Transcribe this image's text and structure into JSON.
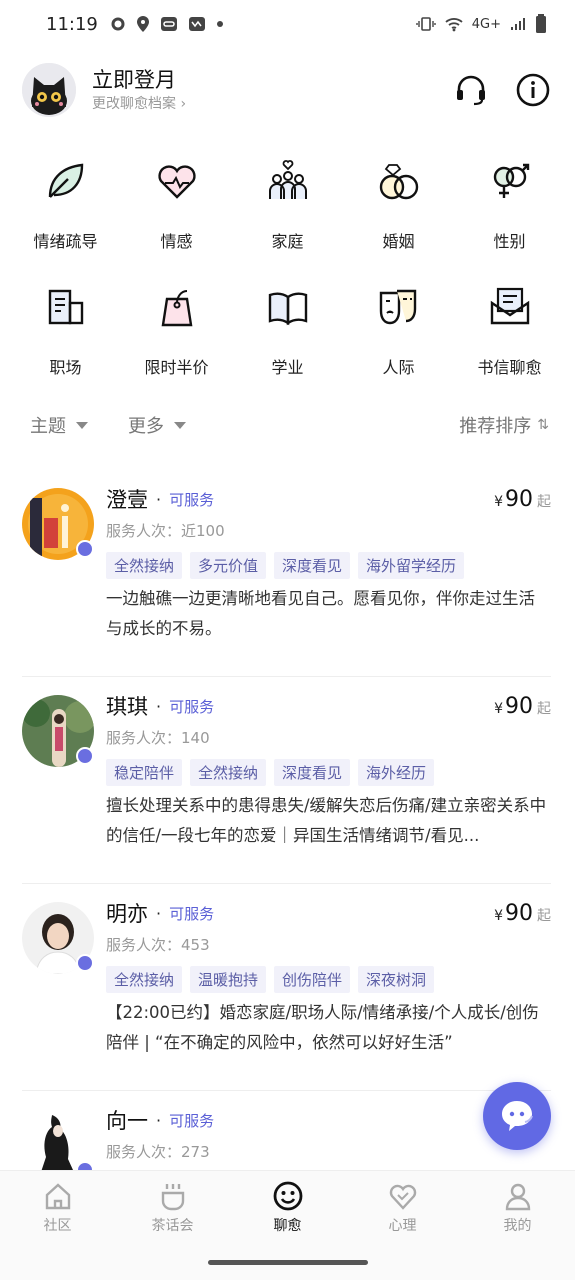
{
  "status_bar": {
    "time": "11:19",
    "network": "4G+"
  },
  "header": {
    "title": "立即登月",
    "subtitle": "更改聊愈档案 ›"
  },
  "categories": [
    {
      "label": "情绪疏导",
      "icon": "leaf-icon"
    },
    {
      "label": "情感",
      "icon": "heart-icon"
    },
    {
      "label": "家庭",
      "icon": "family-icon"
    },
    {
      "label": "婚姻",
      "icon": "rings-icon"
    },
    {
      "label": "性别",
      "icon": "gender-icon"
    },
    {
      "label": "职场",
      "icon": "office-icon"
    },
    {
      "label": "限时半价",
      "icon": "price-tag-icon"
    },
    {
      "label": "学业",
      "icon": "book-icon"
    },
    {
      "label": "人际",
      "icon": "masks-icon"
    },
    {
      "label": "书信聊愈",
      "icon": "letter-icon"
    }
  ],
  "filters": {
    "topic": "主题",
    "more": "更多",
    "sort": "推荐排序",
    "sort_icon": "⇅"
  },
  "counselors": [
    {
      "name": "澄壹",
      "status": "可服务",
      "served": "服务人次：近100",
      "currency": "¥",
      "price": "90",
      "price_suffix": "起",
      "tags": [
        "全然接纳",
        "多元价值",
        "深度看见",
        "海外留学经历"
      ],
      "desc": "一边触礁一边更清晰地看见自己。愿看见你，伴你走过生活与成长的不易。"
    },
    {
      "name": "琪琪",
      "status": "可服务",
      "served": "服务人次：140",
      "currency": "¥",
      "price": "90",
      "price_suffix": "起",
      "tags": [
        "稳定陪伴",
        "全然接纳",
        "深度看见",
        "海外经历"
      ],
      "desc": "擅长处理关系中的患得患失/缓解失恋后伤痛/建立亲密关系中的信任/一段七年的恋爱｜异国生活情绪调节/看见..."
    },
    {
      "name": "明亦",
      "status": "可服务",
      "served": "服务人次：453",
      "currency": "¥",
      "price": "90",
      "price_suffix": "起",
      "tags": [
        "全然接纳",
        "温暖抱持",
        "创伤陪伴",
        "深夜树洞"
      ],
      "desc": "【22:00已约】婚恋家庭/职场人际/情绪承接/个人成长/创伤陪伴 | “在不确定的风险中，依然可以好好生活”"
    },
    {
      "name": "向一",
      "status": "可服务",
      "served": "服务人次：273",
      "currency": "",
      "price": "",
      "price_suffix": "",
      "tags": [],
      "desc": ""
    }
  ],
  "tabs": [
    {
      "label": "社区",
      "icon": "home-icon"
    },
    {
      "label": "茶话会",
      "icon": "tea-cup-icon"
    },
    {
      "label": "聊愈",
      "icon": "smile-icon",
      "active": true
    },
    {
      "label": "心理",
      "icon": "heart-icon"
    },
    {
      "label": "我的",
      "icon": "profile-icon"
    }
  ],
  "colors": {
    "accent": "#5a5fd6",
    "tag_bg": "#f1f1fa",
    "fab": "#6169e4"
  }
}
